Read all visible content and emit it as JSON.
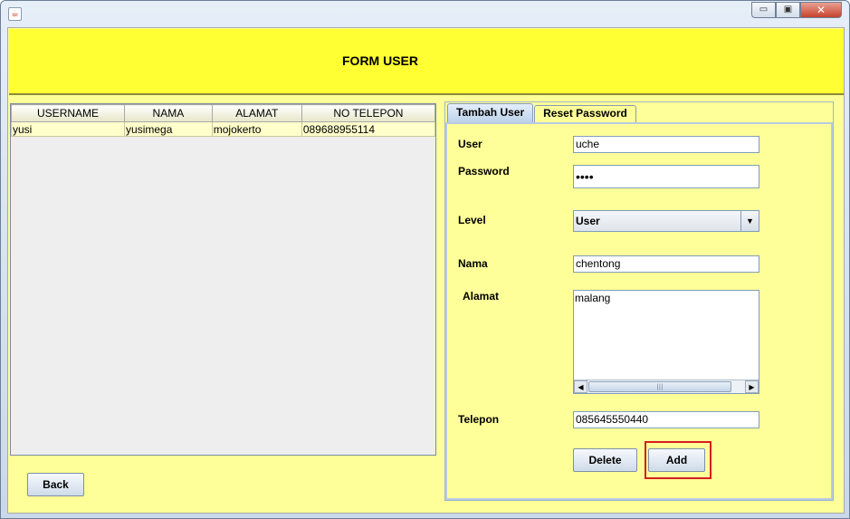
{
  "window": {
    "icon_name": "java-cup-icon",
    "controls": {
      "minimize": "▭",
      "maximize": "▣",
      "close": "✕"
    }
  },
  "header": {
    "title": "FORM USER"
  },
  "table": {
    "columns": [
      "USERNAME",
      "NAMA",
      "ALAMAT",
      "NO TELEPON"
    ],
    "rows": [
      [
        "yusi",
        "yusimega",
        "mojokerto",
        "089688955114"
      ]
    ]
  },
  "buttons": {
    "back": "Back",
    "delete": "Delete",
    "add": "Add"
  },
  "tabs": {
    "active": "Tambah User",
    "inactive": "Reset Password"
  },
  "form": {
    "user_label": "User",
    "user_value": "uche",
    "password_label": "Password",
    "password_value": "••••",
    "level_label": "Level",
    "level_value": "User",
    "nama_label": "Nama",
    "nama_value": "chentong",
    "alamat_label": "Alamat",
    "alamat_value": "malang",
    "telepon_label": "Telepon",
    "telepon_value": "085645550440"
  },
  "colors": {
    "header_bg": "#ffff33",
    "panel_bg": "#ffff99",
    "highlight_border": "#d41f1f"
  }
}
